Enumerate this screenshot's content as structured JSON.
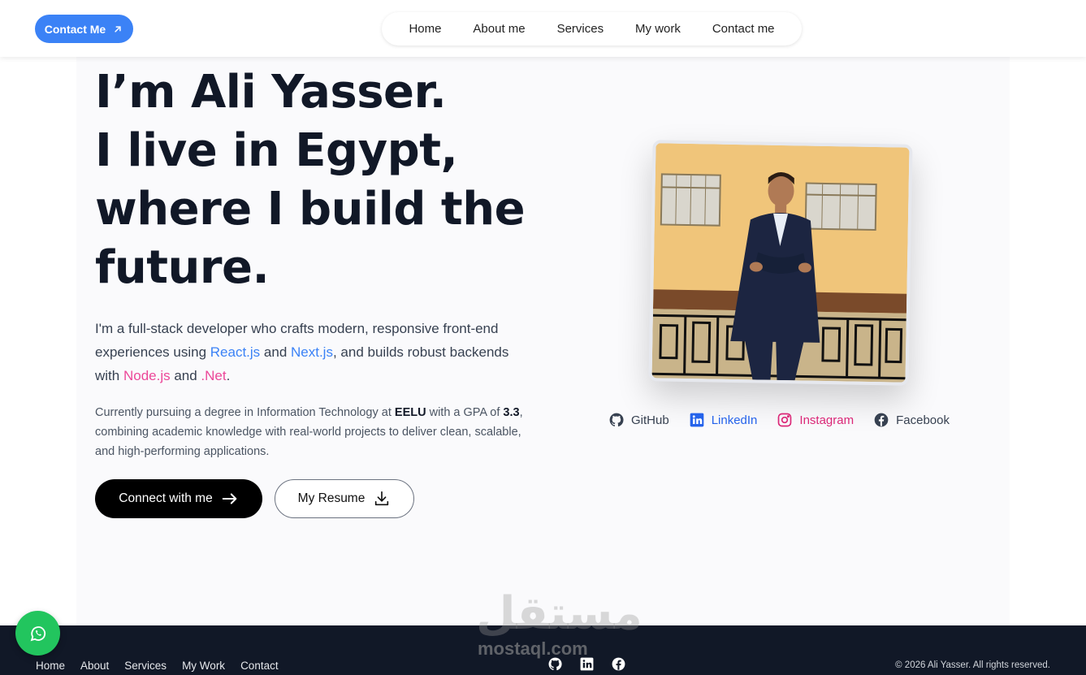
{
  "header": {
    "contact_button": "Contact Me",
    "nav": [
      "Home",
      "About me",
      "Services",
      "My work",
      "Contact me"
    ]
  },
  "hero": {
    "headline": [
      "I’m Ali Yasser.",
      "I live in Egypt,",
      "where I build the",
      "future."
    ],
    "intro": {
      "part1": "I'm a full-stack developer who crafts modern, responsive front-end experiences using ",
      "react": "React.js",
      "and1": " and ",
      "next": "Next.js",
      "part2": ", and builds robust backends with ",
      "node": "Node.js",
      "and2": " and ",
      "net": ".Net",
      "end": "."
    },
    "detail": {
      "part1": "Currently pursuing a degree in Information Technology at ",
      "school": "EELU",
      "part2": " with a GPA of ",
      "gpa": "3.3",
      "part3": ", combining academic knowledge with real-world projects to deliver clean, scalable, and high-performing applications."
    },
    "primary_button": "Connect with me",
    "secondary_button": "My Resume"
  },
  "socials": [
    {
      "label": "GitHub",
      "icon": "github-icon",
      "color": "#374151"
    },
    {
      "label": "LinkedIn",
      "icon": "linkedin-icon",
      "color": "#2563eb"
    },
    {
      "label": "Instagram",
      "icon": "instagram-icon",
      "color": "#db2777"
    },
    {
      "label": "Facebook",
      "icon": "facebook-icon",
      "color": "#374151"
    }
  ],
  "footer": {
    "links": [
      "Home",
      "About",
      "Services",
      "My Work",
      "Contact"
    ],
    "copyright": "© 2026 Ali Yasser. All rights reserved."
  },
  "watermark": {
    "arabic": "مستقل",
    "latin": "mostaql.com"
  },
  "colors": {
    "accent": "#3b82f6",
    "pink": "#ec4899",
    "footer_bg": "#111827",
    "whatsapp": "#22c55e"
  }
}
